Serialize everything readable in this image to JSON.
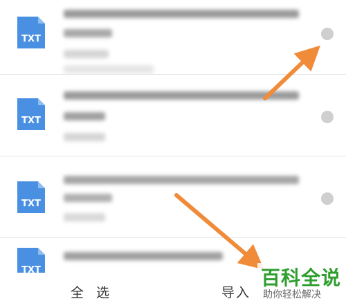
{
  "files": [
    {
      "id": "row1",
      "icon": "txt-file-icon",
      "icon_label": "TXT"
    },
    {
      "id": "row2",
      "icon": "txt-file-icon",
      "icon_label": "TXT"
    },
    {
      "id": "row3",
      "icon": "txt-file-icon",
      "icon_label": "TXT"
    },
    {
      "id": "row4",
      "icon": "txt-file-icon",
      "icon_label": "TXT"
    }
  ],
  "bottom_bar": {
    "select_all": "全 选",
    "import": "导入"
  },
  "watermark": {
    "title": "百科全说",
    "subtitle": "助你轻松解决"
  },
  "colors": {
    "icon_blue": "#4a90e2",
    "arrow": "#f08b3a",
    "radio_gray": "#cfcfcf",
    "watermark_green": "#2e9e2e"
  }
}
